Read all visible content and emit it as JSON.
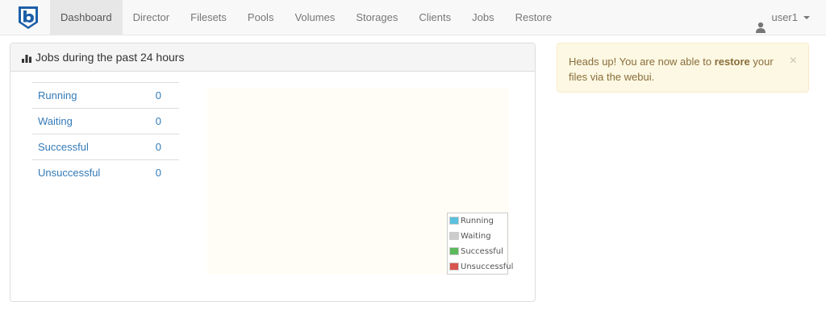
{
  "nav": {
    "logo_icon": "bareos-b-logo-icon",
    "items": [
      {
        "label": "Dashboard",
        "active": true
      },
      {
        "label": "Director"
      },
      {
        "label": "Filesets"
      },
      {
        "label": "Pools"
      },
      {
        "label": "Volumes"
      },
      {
        "label": "Storages"
      },
      {
        "label": "Clients"
      },
      {
        "label": "Jobs"
      },
      {
        "label": "Restore"
      }
    ],
    "user": "user1"
  },
  "panel": {
    "title": "Jobs during the past 24 hours",
    "stats": [
      {
        "label": "Running",
        "value": "0"
      },
      {
        "label": "Waiting",
        "value": "0"
      },
      {
        "label": "Successful",
        "value": "0"
      },
      {
        "label": "Unsuccessful",
        "value": "0"
      }
    ]
  },
  "chart_data": {
    "type": "pie",
    "categories": [
      "Running",
      "Waiting",
      "Successful",
      "Unsuccessful"
    ],
    "values": [
      0,
      0,
      0,
      0
    ],
    "colors": [
      "#5bc0de",
      "#cccccc",
      "#5cb85c",
      "#d9534f"
    ],
    "legend": "bottom-right"
  },
  "alert": {
    "prefix": "Heads up! You are now able to ",
    "bold": "restore",
    "suffix": " your files via the webui.",
    "close": "×"
  },
  "colors": {
    "link": "#337ab7",
    "alert_bg": "#fcf8e3",
    "alert_text": "#8a6d3b",
    "brand_blue": "#1d5fa8"
  }
}
